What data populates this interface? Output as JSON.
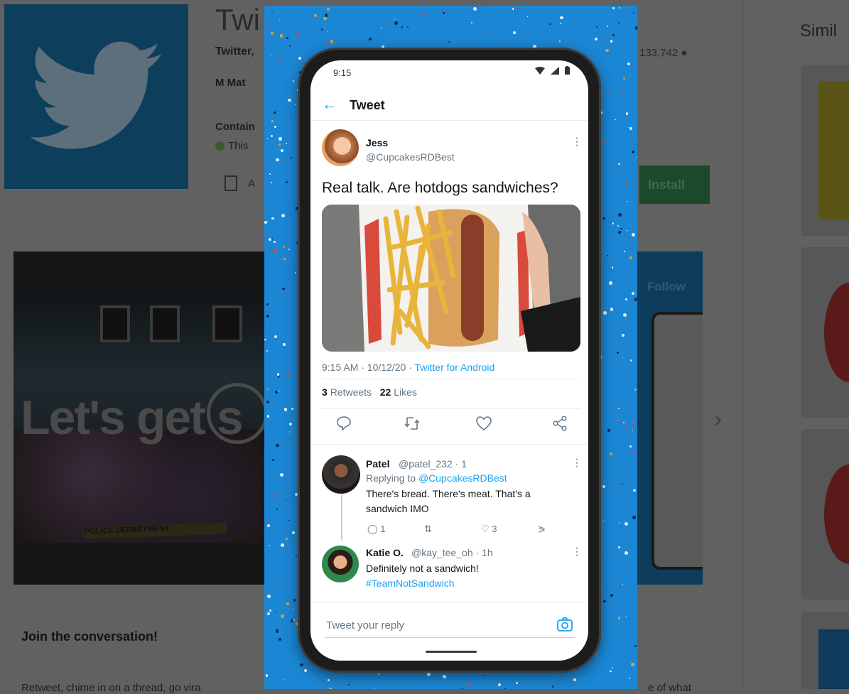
{
  "store": {
    "title_partial": "Twi",
    "developer_partial": "Twitter,",
    "rating_badge_partial": "Mat",
    "contains_partial": "Contain",
    "this_partial": "This",
    "wishlist_partial": "A",
    "install_label": "Install",
    "downloads_partial": "133,742",
    "similar_partial": "Simil",
    "video_text": "Let's get s",
    "video_tape": "POLICE DEPARTMENT",
    "screenshot2_follow": "Follow",
    "about_heading": "Join the conversation!",
    "about_text_partial_left": "Retweet, chime in on a thread, go vira",
    "about_text_partial_right": "e of what"
  },
  "phone": {
    "status_time": "9:15",
    "header_title": "Tweet",
    "tweet": {
      "author_name": "Jess",
      "author_handle": "@CupcakesRDBest",
      "text": "Real talk. Are hotdogs sandwiches?",
      "time": "9:15 AM · 10/12/20 · ",
      "source": "Twitter for Android",
      "retweets_count": "3",
      "retweets_label": "Retweets",
      "likes_count": "22",
      "likes_label": "Likes"
    },
    "replies": [
      {
        "name": "Patel",
        "handle": "@patel_232 · 1",
        "replying_prefix": "Replying to ",
        "replying_to": "@CupcakesRDBest",
        "text_line1": "There's bread. There's meat. That's a",
        "text_line2": "sandwich IMO",
        "reply_count": "1",
        "like_count": "3"
      },
      {
        "name": "Katie O.",
        "handle": "@kay_tee_oh · 1h",
        "text_line1": "Definitely not a sandwich!",
        "hashtag": "#TeamNotSandwich"
      }
    ],
    "reply_placeholder": "Tweet your reply"
  },
  "colors": {
    "twitter_blue": "#1da1f2",
    "panel_blue": "#1b86d3",
    "dim_overlay": "#616161"
  }
}
